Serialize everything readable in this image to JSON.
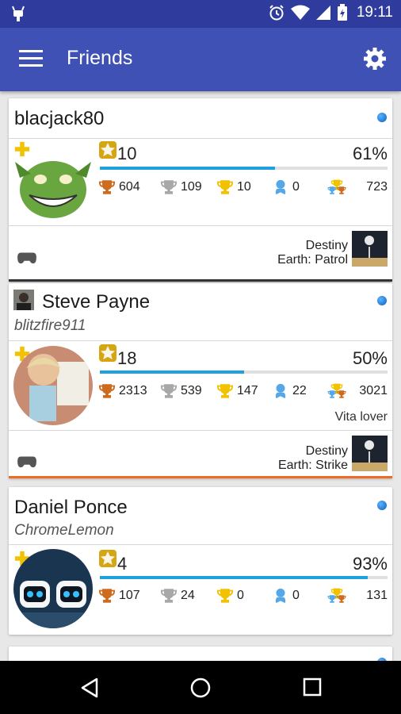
{
  "status_bar": {
    "time": "19:11"
  },
  "app_bar": {
    "title": "Friends"
  },
  "friends": [
    {
      "online_id": "blacjack80",
      "level": "10",
      "progress_percent": 61,
      "progress_label": "61%",
      "trophies": {
        "bronze": "604",
        "silver": "109",
        "gold": "10",
        "platinum": "0",
        "total": "723"
      },
      "game": "Destiny",
      "activity": "Earth: Patrol"
    },
    {
      "real_name": "Steve Payne",
      "online_id": "blitzfire911",
      "level": "18",
      "progress_percent": 50,
      "progress_label": "50%",
      "trophies": {
        "bronze": "2313",
        "silver": "539",
        "gold": "147",
        "platinum": "22",
        "total": "3021"
      },
      "about_me": "Vita lover",
      "game": "Destiny",
      "activity": "Earth: Strike"
    },
    {
      "real_name": "Daniel Ponce",
      "online_id": "ChromeLemon",
      "level": "4",
      "progress_percent": 93,
      "progress_label": "93%",
      "trophies": {
        "bronze": "107",
        "silver": "24",
        "gold": "0",
        "platinum": "0",
        "total": "131"
      }
    }
  ],
  "colors": {
    "primary": "#3f51b5",
    "status_bar": "#2f3c9e",
    "progress": "#1fa0e0",
    "online": "#1e88e5",
    "playing_dark": "#333333",
    "playing_orange": "#ef6c27"
  }
}
